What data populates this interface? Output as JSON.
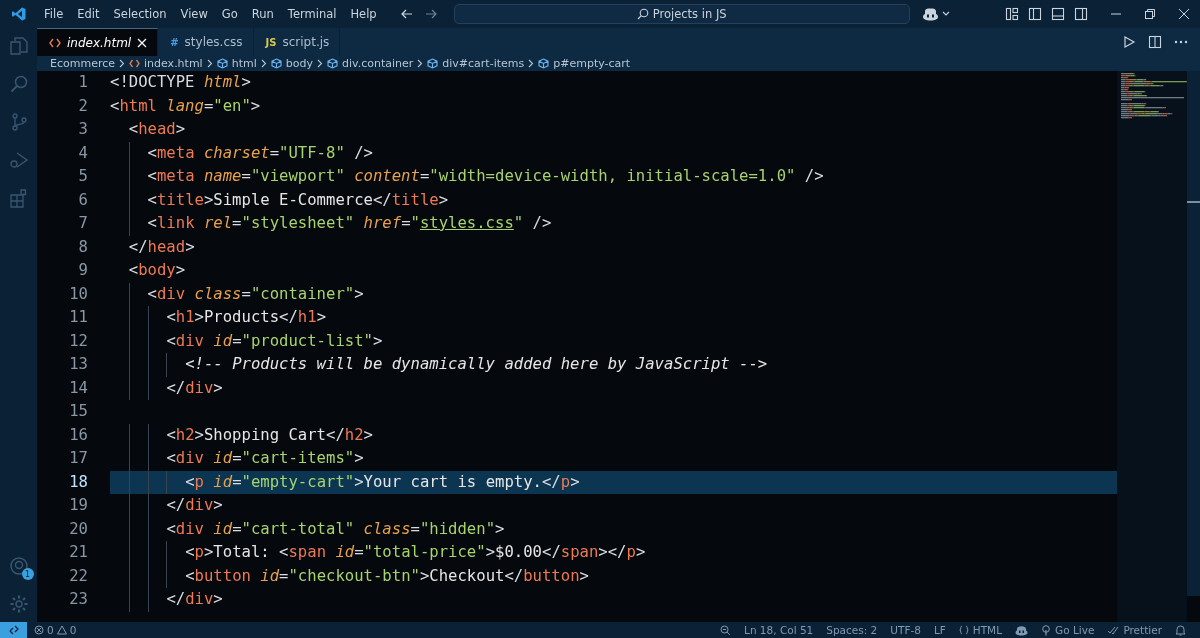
{
  "title_bar": {
    "menus": [
      "File",
      "Edit",
      "Selection",
      "View",
      "Go",
      "Run",
      "Terminal",
      "Help"
    ],
    "search": {
      "value": "Projects in JS"
    }
  },
  "activity_bar": {
    "accounts_badge": "1"
  },
  "tabs": [
    {
      "label": "index.html",
      "kind": "html",
      "selected": true
    },
    {
      "label": "styles.css",
      "kind": "css",
      "glyph": "#",
      "selected": false
    },
    {
      "label": "script.js",
      "kind": "js",
      "glyph": "JS",
      "selected": false
    }
  ],
  "breadcrumbs": [
    {
      "label": "Ecommerce",
      "kind": "folder"
    },
    {
      "label": "index.html",
      "kind": "file"
    },
    {
      "label": "html",
      "kind": "element"
    },
    {
      "label": "body",
      "kind": "element"
    },
    {
      "label": "div.container",
      "kind": "element"
    },
    {
      "label": "div#cart-items",
      "kind": "element"
    },
    {
      "label": "p#empty-cart",
      "kind": "element"
    }
  ],
  "editor": {
    "lines": [
      {
        "number": "1",
        "current": false,
        "tokens": [
          {
            "kind": "punct",
            "text": "<!DOCTYPE"
          },
          {
            "kind": "attr",
            "text": " html"
          },
          {
            "kind": "punct",
            "text": ">"
          }
        ]
      },
      {
        "number": "2",
        "current": false,
        "tokens": [
          {
            "kind": "punct",
            "text": "<"
          },
          {
            "kind": "tag",
            "text": "html"
          },
          {
            "kind": "attr",
            "text": " lang"
          },
          {
            "kind": "punct",
            "text": "="
          },
          {
            "kind": "string",
            "text": "\"en\""
          },
          {
            "kind": "punct",
            "text": ">"
          }
        ]
      },
      {
        "number": "3",
        "current": false,
        "tokens": [
          {
            "kind": "punct",
            "text": "  <"
          },
          {
            "kind": "tag",
            "text": "head"
          },
          {
            "kind": "punct",
            "text": ">"
          }
        ]
      },
      {
        "number": "4",
        "current": false,
        "tokens": [
          {
            "kind": "punct",
            "text": "    <"
          },
          {
            "kind": "tag",
            "text": "meta"
          },
          {
            "kind": "attr",
            "text": " charset"
          },
          {
            "kind": "punct",
            "text": "="
          },
          {
            "kind": "string",
            "text": "\"UTF-8\""
          },
          {
            "kind": "punct",
            "text": " />"
          }
        ]
      },
      {
        "number": "5",
        "current": false,
        "tokens": [
          {
            "kind": "punct",
            "text": "    <"
          },
          {
            "kind": "tag",
            "text": "meta"
          },
          {
            "kind": "attr",
            "text": " name"
          },
          {
            "kind": "punct",
            "text": "="
          },
          {
            "kind": "string",
            "text": "\"viewport\""
          },
          {
            "kind": "attr",
            "text": " content"
          },
          {
            "kind": "punct",
            "text": "="
          },
          {
            "kind": "string",
            "text": "\"width=device-width, initial-scale=1.0\""
          },
          {
            "kind": "punct",
            "text": " />"
          }
        ]
      },
      {
        "number": "6",
        "current": false,
        "tokens": [
          {
            "kind": "punct",
            "text": "    <"
          },
          {
            "kind": "tag",
            "text": "title"
          },
          {
            "kind": "punct",
            "text": ">"
          },
          {
            "kind": "text",
            "text": "Simple E-Commerce"
          },
          {
            "kind": "punct",
            "text": "</"
          },
          {
            "kind": "tag",
            "text": "title"
          },
          {
            "kind": "punct",
            "text": ">"
          }
        ]
      },
      {
        "number": "7",
        "current": false,
        "tokens": [
          {
            "kind": "punct",
            "text": "    <"
          },
          {
            "kind": "tag",
            "text": "link"
          },
          {
            "kind": "attr",
            "text": " rel"
          },
          {
            "kind": "punct",
            "text": "="
          },
          {
            "kind": "string",
            "text": "\"stylesheet\""
          },
          {
            "kind": "attr",
            "text": " href"
          },
          {
            "kind": "punct",
            "text": "="
          },
          {
            "kind": "string",
            "text": "\""
          },
          {
            "kind": "link",
            "text": "styles.css"
          },
          {
            "kind": "string",
            "text": "\""
          },
          {
            "kind": "punct",
            "text": " />"
          }
        ]
      },
      {
        "number": "8",
        "current": false,
        "tokens": [
          {
            "kind": "punct",
            "text": "  </"
          },
          {
            "kind": "tag",
            "text": "head"
          },
          {
            "kind": "punct",
            "text": ">"
          }
        ]
      },
      {
        "number": "9",
        "current": false,
        "tokens": [
          {
            "kind": "punct",
            "text": "  <"
          },
          {
            "kind": "tag",
            "text": "body"
          },
          {
            "kind": "punct",
            "text": ">"
          }
        ]
      },
      {
        "number": "10",
        "current": false,
        "tokens": [
          {
            "kind": "punct",
            "text": "    <"
          },
          {
            "kind": "tag",
            "text": "div"
          },
          {
            "kind": "attr",
            "text": " class"
          },
          {
            "kind": "punct",
            "text": "="
          },
          {
            "kind": "string",
            "text": "\"container\""
          },
          {
            "kind": "punct",
            "text": ">"
          }
        ]
      },
      {
        "number": "11",
        "current": false,
        "tokens": [
          {
            "kind": "punct",
            "text": "      <"
          },
          {
            "kind": "tag",
            "text": "h1"
          },
          {
            "kind": "punct",
            "text": ">"
          },
          {
            "kind": "text",
            "text": "Products"
          },
          {
            "kind": "punct",
            "text": "</"
          },
          {
            "kind": "tag",
            "text": "h1"
          },
          {
            "kind": "punct",
            "text": ">"
          }
        ]
      },
      {
        "number": "12",
        "current": false,
        "tokens": [
          {
            "kind": "punct",
            "text": "      <"
          },
          {
            "kind": "tag",
            "text": "div"
          },
          {
            "kind": "attr",
            "text": " id"
          },
          {
            "kind": "punct",
            "text": "="
          },
          {
            "kind": "string",
            "text": "\"product-list\""
          },
          {
            "kind": "punct",
            "text": ">"
          }
        ]
      },
      {
        "number": "13",
        "current": false,
        "tokens": [
          {
            "kind": "comment",
            "text": "        <!-- Products will be dynamically added here by JavaScript -->"
          }
        ]
      },
      {
        "number": "14",
        "current": false,
        "tokens": [
          {
            "kind": "punct",
            "text": "      </"
          },
          {
            "kind": "tag",
            "text": "div"
          },
          {
            "kind": "punct",
            "text": ">"
          }
        ]
      },
      {
        "number": "15",
        "current": false
      },
      {
        "number": "16",
        "current": false,
        "tokens": [
          {
            "kind": "punct",
            "text": "      <"
          },
          {
            "kind": "tag",
            "text": "h2"
          },
          {
            "kind": "punct",
            "text": ">"
          },
          {
            "kind": "text",
            "text": "Shopping Cart"
          },
          {
            "kind": "punct",
            "text": "</"
          },
          {
            "kind": "tag",
            "text": "h2"
          },
          {
            "kind": "punct",
            "text": ">"
          }
        ]
      },
      {
        "number": "17",
        "current": false,
        "tokens": [
          {
            "kind": "punct",
            "text": "      <"
          },
          {
            "kind": "tag",
            "text": "div"
          },
          {
            "kind": "attr",
            "text": " id"
          },
          {
            "kind": "punct",
            "text": "="
          },
          {
            "kind": "string",
            "text": "\"cart-items\""
          },
          {
            "kind": "punct",
            "text": ">"
          }
        ]
      },
      {
        "number": "18",
        "current": true,
        "tokens": [
          {
            "kind": "punct",
            "text": "        <"
          },
          {
            "kind": "tag",
            "text": "p"
          },
          {
            "kind": "attr",
            "text": " id"
          },
          {
            "kind": "punct",
            "text": "="
          },
          {
            "kind": "string",
            "text": "\"empty-cart\""
          },
          {
            "kind": "punct",
            "text": ">"
          },
          {
            "kind": "text",
            "text": "Your cart is empty."
          },
          {
            "kind": "punct",
            "text": "</"
          },
          {
            "kind": "tag",
            "text": "p"
          },
          {
            "kind": "punct",
            "text": ">"
          }
        ]
      },
      {
        "number": "19",
        "current": false,
        "tokens": [
          {
            "kind": "punct",
            "text": "      </"
          },
          {
            "kind": "tag",
            "text": "div"
          },
          {
            "kind": "punct",
            "text": ">"
          }
        ]
      },
      {
        "number": "20",
        "current": false,
        "tokens": [
          {
            "kind": "punct",
            "text": "      <"
          },
          {
            "kind": "tag",
            "text": "div"
          },
          {
            "kind": "attr",
            "text": " id"
          },
          {
            "kind": "punct",
            "text": "="
          },
          {
            "kind": "string",
            "text": "\"cart-total\""
          },
          {
            "kind": "attr",
            "text": " class"
          },
          {
            "kind": "punct",
            "text": "="
          },
          {
            "kind": "string",
            "text": "\"hidden\""
          },
          {
            "kind": "punct",
            "text": ">"
          }
        ]
      },
      {
        "number": "21",
        "current": false,
        "tokens": [
          {
            "kind": "punct",
            "text": "        <"
          },
          {
            "kind": "tag",
            "text": "p"
          },
          {
            "kind": "punct",
            "text": ">"
          },
          {
            "kind": "text",
            "text": "Total: "
          },
          {
            "kind": "punct",
            "text": "<"
          },
          {
            "kind": "tag",
            "text": "span"
          },
          {
            "kind": "attr",
            "text": " id"
          },
          {
            "kind": "punct",
            "text": "="
          },
          {
            "kind": "string",
            "text": "\"total-price\""
          },
          {
            "kind": "punct",
            "text": ">"
          },
          {
            "kind": "text",
            "text": "$0.00"
          },
          {
            "kind": "punct",
            "text": "</"
          },
          {
            "kind": "tag",
            "text": "span"
          },
          {
            "kind": "punct",
            "text": "></"
          },
          {
            "kind": "tag",
            "text": "p"
          },
          {
            "kind": "punct",
            "text": ">"
          }
        ]
      },
      {
        "number": "22",
        "current": false,
        "tokens": [
          {
            "kind": "punct",
            "text": "        <"
          },
          {
            "kind": "tag",
            "text": "button"
          },
          {
            "kind": "attr",
            "text": " id"
          },
          {
            "kind": "punct",
            "text": "="
          },
          {
            "kind": "string",
            "text": "\"checkout-btn\""
          },
          {
            "kind": "punct",
            "text": ">"
          },
          {
            "kind": "text",
            "text": "Checkout"
          },
          {
            "kind": "punct",
            "text": "</"
          },
          {
            "kind": "tag",
            "text": "button"
          },
          {
            "kind": "punct",
            "text": ">"
          }
        ]
      },
      {
        "number": "23",
        "current": false,
        "tokens": [
          {
            "kind": "punct",
            "text": "      </"
          },
          {
            "kind": "tag",
            "text": "div"
          },
          {
            "kind": "punct",
            "text": ">"
          }
        ]
      }
    ]
  },
  "status_bar": {
    "errors": "0",
    "warnings": "0",
    "items": [
      {
        "kind": "position",
        "label": "Ln 18, Col 51"
      },
      {
        "kind": "indent",
        "label": "Spaces: 2"
      },
      {
        "kind": "encoding",
        "label": "UTF-8"
      },
      {
        "kind": "eol",
        "label": "LF"
      },
      {
        "kind": "language",
        "label": "HTML"
      },
      {
        "kind": "copilot"
      },
      {
        "kind": "live",
        "label": "Go Live"
      },
      {
        "kind": "prettier",
        "label": "Prettier"
      },
      {
        "kind": "bell"
      }
    ]
  }
}
